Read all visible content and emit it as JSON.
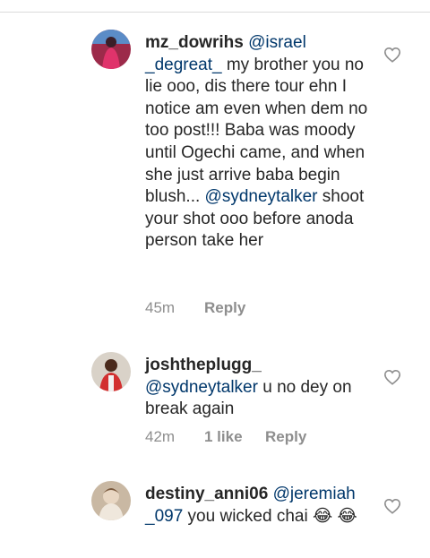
{
  "comments": [
    {
      "username": "mz_dowrihs",
      "mention": "@israel _degreat_",
      "text": " my brother you no lie ooo, dis there tour ehn I notice am even when dem no too post!!! Baba was moody until Ogechi came, and when she just arrive baba begin blush... ",
      "mention2": "@sydneytalker",
      "text2": " shoot your shot ooo before anoda person take her",
      "time": "45m",
      "likes": "",
      "reply": "Reply",
      "avatar_icon": "user-avatar-icon"
    },
    {
      "username": "joshtheplugg_",
      "mention": "@sydneytalker",
      "text": " u no dey on break again",
      "time": "42m",
      "likes": "1 like",
      "reply": "Reply",
      "avatar_icon": "user-avatar-icon"
    },
    {
      "username": "destiny_anni06",
      "mention": "@jeremiah _097",
      "text": " you wicked chai 😂 😂",
      "avatar_icon": "user-avatar-icon"
    }
  ],
  "colors": {
    "text": "#262626",
    "mention": "#00376b",
    "meta": "#8e8e8e",
    "divider": "#dbdbdb"
  }
}
